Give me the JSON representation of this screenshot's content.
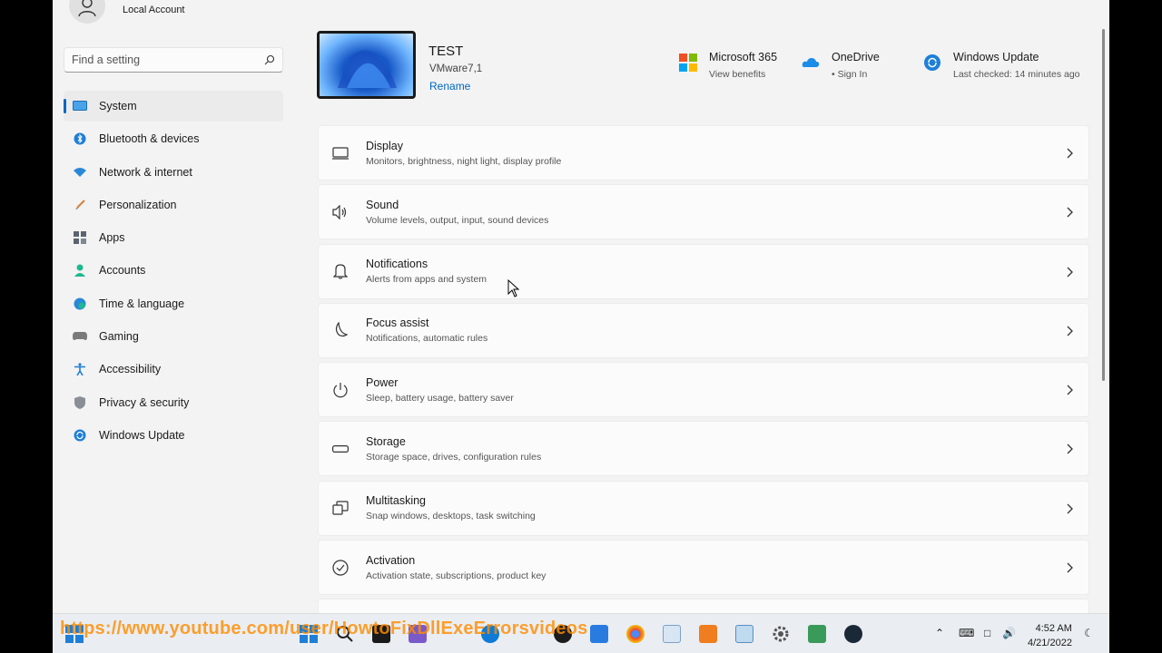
{
  "account": {
    "label": "Local Account"
  },
  "search": {
    "placeholder": "Find a setting"
  },
  "sidebar": {
    "items": [
      {
        "label": "System",
        "icon": "display-icon",
        "active": true
      },
      {
        "label": "Bluetooth & devices",
        "icon": "bluetooth-icon"
      },
      {
        "label": "Network & internet",
        "icon": "wifi-icon"
      },
      {
        "label": "Personalization",
        "icon": "brush-icon"
      },
      {
        "label": "Apps",
        "icon": "apps-icon"
      },
      {
        "label": "Accounts",
        "icon": "person-icon"
      },
      {
        "label": "Time & language",
        "icon": "globe-clock-icon"
      },
      {
        "label": "Gaming",
        "icon": "gamepad-icon"
      },
      {
        "label": "Accessibility",
        "icon": "accessibility-icon"
      },
      {
        "label": "Privacy & security",
        "icon": "shield-icon"
      },
      {
        "label": "Windows Update",
        "icon": "update-icon"
      }
    ]
  },
  "device": {
    "name": "TEST",
    "model": "VMware7,1",
    "rename": "Rename"
  },
  "header": {
    "microsoft365": {
      "title": "Microsoft 365",
      "sub": "View benefits"
    },
    "onedrive": {
      "title": "OneDrive",
      "sub": "• Sign In"
    },
    "windows_update": {
      "title": "Windows Update",
      "sub": "Last checked: 14 minutes ago"
    }
  },
  "cards": [
    {
      "title": "Display",
      "sub": "Monitors, brightness, night light, display profile",
      "icon": "monitor-icon"
    },
    {
      "title": "Sound",
      "sub": "Volume levels, output, input, sound devices",
      "icon": "speaker-icon"
    },
    {
      "title": "Notifications",
      "sub": "Alerts from apps and system",
      "icon": "bell-icon"
    },
    {
      "title": "Focus assist",
      "sub": "Notifications, automatic rules",
      "icon": "moon-icon"
    },
    {
      "title": "Power",
      "sub": "Sleep, battery usage, battery saver",
      "icon": "power-icon"
    },
    {
      "title": "Storage",
      "sub": "Storage space, drives, configuration rules",
      "icon": "storage-icon"
    },
    {
      "title": "Multitasking",
      "sub": "Snap windows, desktops, task switching",
      "icon": "multitask-icon"
    },
    {
      "title": "Activation",
      "sub": "Activation state, subscriptions, product key",
      "icon": "check-circle-icon"
    }
  ],
  "taskbar": {
    "time": "4:52 AM",
    "date": "4/21/2022"
  },
  "watermark": "https://www.youtube.com/user/HowtoFixDllExeErrorsvideos",
  "colors": {
    "accent": "#0067c0",
    "background": "#f3f3f3",
    "card": "#fbfbfb"
  }
}
